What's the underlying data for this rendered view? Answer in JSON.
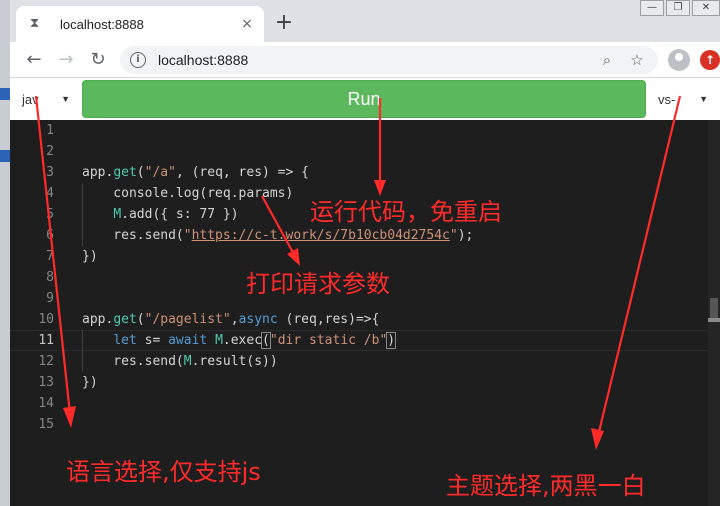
{
  "browser": {
    "tab_title": "localhost:8888",
    "new_tab_label": "+",
    "tab_close": "×",
    "url": "localhost:8888",
    "window_controls": [
      "—",
      "❐",
      "✕"
    ]
  },
  "controls": {
    "language_value": "jav",
    "run_label": "Run",
    "theme_value": "vs-"
  },
  "editor": {
    "line_numbers": [
      "1",
      "2",
      "3",
      "4",
      "5",
      "6",
      "7",
      "8",
      "9",
      "10",
      "11",
      "12",
      "13",
      "14",
      "15"
    ],
    "active_line": "11"
  },
  "annotations": {
    "run_note": "运行代码，免重启",
    "params_note": "打印请求参数",
    "language_note": "语言选择,仅支持js",
    "theme_note": "主题选择,两黑一白"
  },
  "colors": {
    "run_button": "#5cb85c",
    "editor_bg": "#1e1e1e",
    "annotation": "#ff2a2a"
  }
}
